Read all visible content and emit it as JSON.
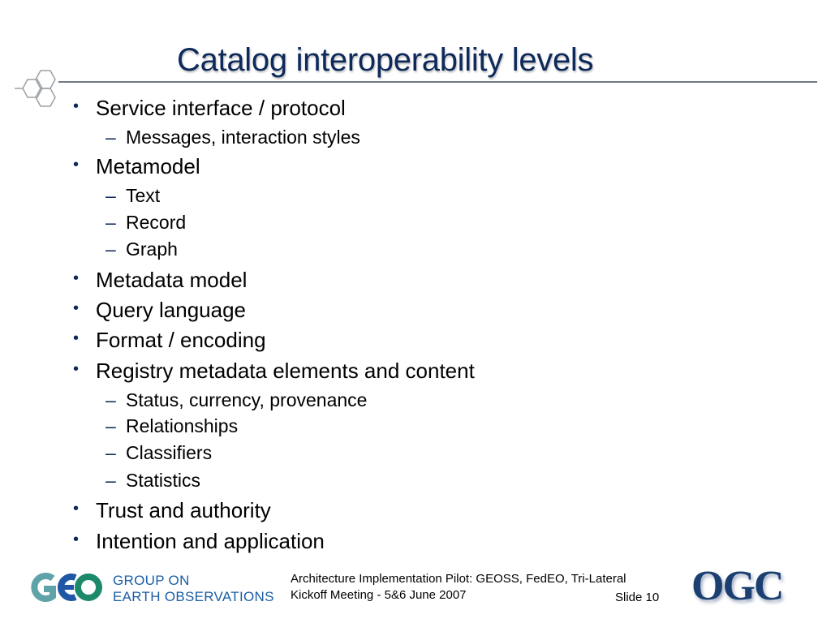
{
  "slide": {
    "title": "Catalog interoperability levels",
    "items": [
      {
        "level": 1,
        "text": "Service interface / protocol"
      },
      {
        "level": 2,
        "text": "Messages, interaction styles"
      },
      {
        "level": 1,
        "text": "Metamodel"
      },
      {
        "level": 2,
        "text": "Text"
      },
      {
        "level": 2,
        "text": "Record"
      },
      {
        "level": 2,
        "text": "Graph"
      },
      {
        "level": 1,
        "text": "Metadata model"
      },
      {
        "level": 1,
        "text": "Query language"
      },
      {
        "level": 1,
        "text": "Format / encoding"
      },
      {
        "level": 1,
        "text": "Registry metadata elements and content"
      },
      {
        "level": 2,
        "text": "Status, currency, provenance"
      },
      {
        "level": 2,
        "text": "Relationships"
      },
      {
        "level": 2,
        "text": "Classifiers"
      },
      {
        "level": 2,
        "text": "Statistics"
      },
      {
        "level": 1,
        "text": "Trust and authority"
      },
      {
        "level": 1,
        "text": "Intention and application"
      }
    ],
    "bullet_glyph": "•",
    "dash_glyph": "–"
  },
  "footer": {
    "geo_logo_text": "GEO",
    "geo_line1": "GROUP ON",
    "geo_line2": "EARTH OBSERVATIONS",
    "meeting_line1": "Architecture Implementation Pilot: GEOSS, FedEO, Tri-Lateral",
    "meeting_line2": "Kickoff Meeting - 5&6 June 2007",
    "slide_number": "Slide 10",
    "ogc_logo_text": "OGC"
  },
  "colors": {
    "title": "#0e2a5a",
    "geo_teal": "#5fa3a8",
    "geo_blue": "#1f56a6",
    "geo_green": "#1c8a6a",
    "ogc_blue": "#1c3f72"
  }
}
